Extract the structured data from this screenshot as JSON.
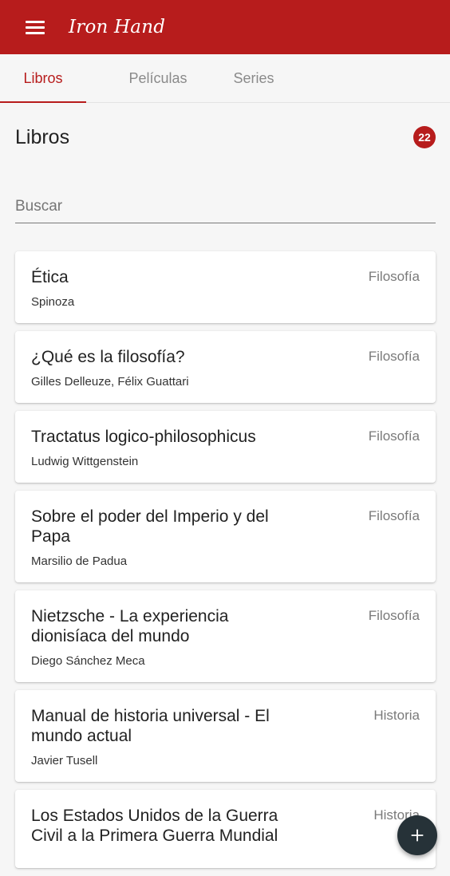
{
  "app_bar": {
    "title": "Iron Hand",
    "color": "#b71c1c",
    "menu_icon": "menu-icon"
  },
  "tabs": [
    {
      "label": "Libros",
      "active": true
    },
    {
      "label": "Películas",
      "active": false
    },
    {
      "label": "Series",
      "active": false
    }
  ],
  "section": {
    "title": "Libros",
    "count": "22"
  },
  "search": {
    "placeholder": "Buscar",
    "value": ""
  },
  "items": [
    {
      "title": "Ética",
      "author": "Spinoza",
      "category": "Filosofía"
    },
    {
      "title": "¿Qué es la filosofía?",
      "author": "Gilles Delleuze, Félix Guattari",
      "category": "Filosofía"
    },
    {
      "title": "Tractatus logico-philosophicus",
      "author": "Ludwig Wittgenstein",
      "category": "Filosofía"
    },
    {
      "title": "Sobre el poder del Imperio y del Papa",
      "author": "Marsilio de Padua",
      "category": "Filosofía"
    },
    {
      "title": "Nietzsche - La experiencia dionisíaca del mundo",
      "author": "Diego Sánchez Meca",
      "category": "Filosofía"
    },
    {
      "title": "Manual de historia universal - El mundo actual",
      "author": "Javier Tusell",
      "category": "Historia"
    },
    {
      "title": "Los Estados Unidos de la Guerra Civil a la Primera Guerra Mundial",
      "author": "",
      "category": "Historia"
    }
  ],
  "fab": {
    "icon": "plus-icon",
    "color": "#263238"
  }
}
